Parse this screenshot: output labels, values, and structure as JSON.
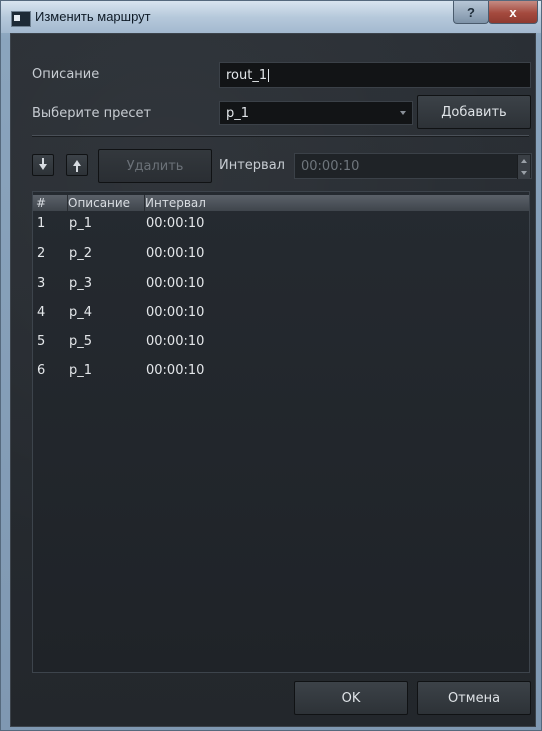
{
  "window": {
    "title": "Изменить маршрут",
    "help_label": "?",
    "close_label": "x"
  },
  "form": {
    "description_label": "Описание",
    "description_value": "rout_1",
    "preset_label": "Выберите пресет",
    "preset_value": "p_1",
    "add_label": "Добавить"
  },
  "toolbar": {
    "delete_label": "Удалить",
    "interval_label": "Интервал",
    "interval_value": "00:00:10"
  },
  "table": {
    "columns": [
      "#",
      "Описание",
      "Интервал"
    ],
    "rows": [
      {
        "n": "1",
        "desc": "p_1",
        "interval": "00:00:10"
      },
      {
        "n": "2",
        "desc": "p_2",
        "interval": "00:00:10"
      },
      {
        "n": "3",
        "desc": "p_3",
        "interval": "00:00:10"
      },
      {
        "n": "4",
        "desc": "p_4",
        "interval": "00:00:10"
      },
      {
        "n": "5",
        "desc": "p_5",
        "interval": "00:00:10"
      },
      {
        "n": "6",
        "desc": "p_1",
        "interval": "00:00:10"
      }
    ]
  },
  "footer": {
    "ok_label": "OK",
    "cancel_label": "Отмена"
  },
  "icons": [
    "app-icon",
    "arrow-down-icon",
    "arrow-up-icon",
    "chevron-down-icon",
    "spin-icon"
  ]
}
